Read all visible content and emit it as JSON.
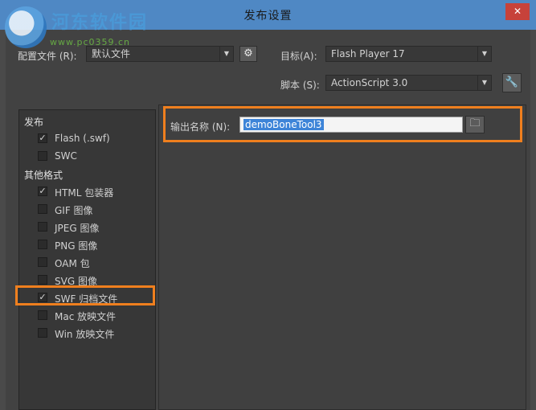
{
  "window": {
    "title": "发布设置",
    "close_glyph": "✕"
  },
  "watermark": {
    "text": "河东软件园",
    "url": "www.pc0359.cn"
  },
  "profile": {
    "label": "配置文件 (R):",
    "value": "默认文件",
    "gear_icon": "gear-icon"
  },
  "target": {
    "label": "目标(A):",
    "value": "Flash Player 17"
  },
  "script": {
    "label": "脚本 (S):",
    "value": "ActionScript 3.0",
    "wrench_icon": "wrench-icon"
  },
  "left": {
    "publish_heading": "发布",
    "other_heading": "其他格式",
    "items": [
      {
        "label": "Flash (.swf)",
        "checked": true
      },
      {
        "label": "SWC",
        "checked": false
      },
      {
        "label": "HTML 包装器",
        "checked": true
      },
      {
        "label": "GIF 图像",
        "checked": false
      },
      {
        "label": "JPEG 图像",
        "checked": false
      },
      {
        "label": "PNG 图像",
        "checked": false
      },
      {
        "label": "OAM 包",
        "checked": false
      },
      {
        "label": "SVG 图像",
        "checked": false
      },
      {
        "label": "SWF 归档文件",
        "checked": true
      },
      {
        "label": "Mac 放映文件",
        "checked": false
      },
      {
        "label": "Win 放映文件",
        "checked": false
      }
    ]
  },
  "output": {
    "label": "输出名称 (N):",
    "value": "demoBoneTool3",
    "folder_icon": "folder-icon"
  },
  "colors": {
    "accent": "#ef7f1e",
    "titlebar": "#4f88c4",
    "selection": "#3d84d8"
  }
}
